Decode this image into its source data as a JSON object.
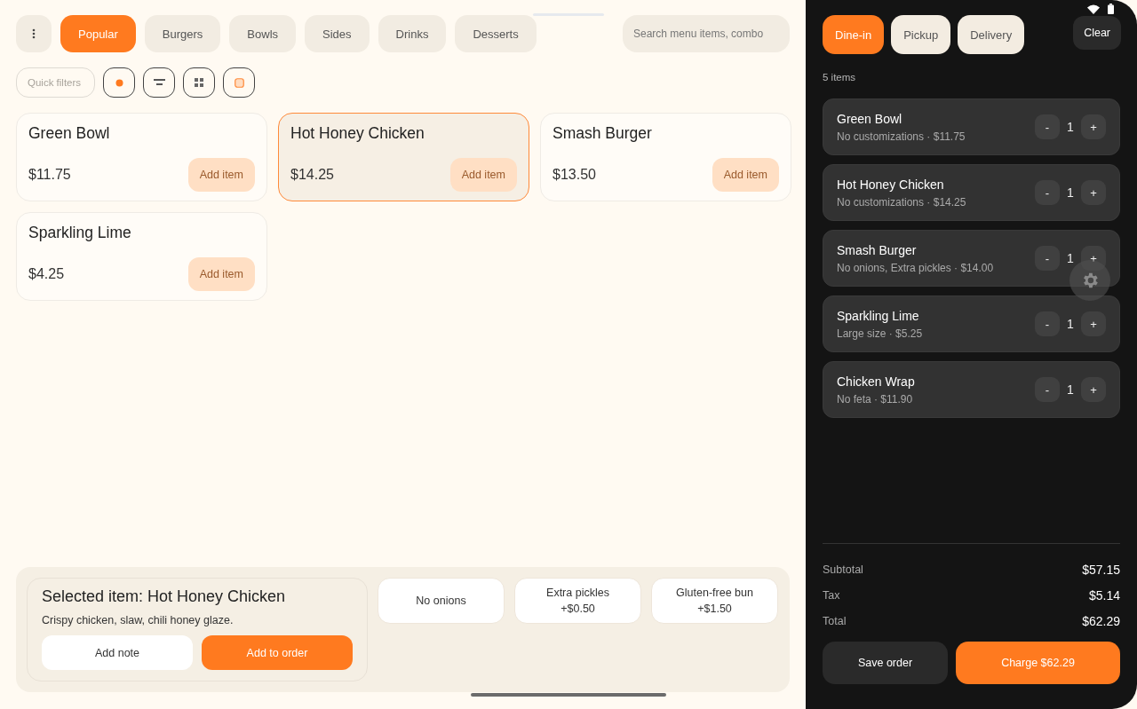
{
  "categories": [
    {
      "label": "Popular",
      "selected": true
    },
    {
      "label": "Burgers",
      "selected": false
    },
    {
      "label": "Bowls",
      "selected": false
    },
    {
      "label": "Sides",
      "selected": false
    },
    {
      "label": "Drinks",
      "selected": false
    },
    {
      "label": "Desserts",
      "selected": false
    }
  ],
  "search": {
    "placeholder": "Search menu items, combo"
  },
  "quick_filters": {
    "placeholder": "Quick filters",
    "buttons": [
      {
        "kind": "dot"
      },
      {
        "kind": "lines"
      },
      {
        "kind": "grid"
      },
      {
        "kind": "square"
      }
    ]
  },
  "menu_items": [
    {
      "name": "Green Bowl",
      "price": "$11.75",
      "button": "Add item",
      "selected": false
    },
    {
      "name": "Hot Honey Chicken",
      "price": "$14.25",
      "button": "Add item",
      "selected": true
    },
    {
      "name": "Smash Burger",
      "price": "$13.50",
      "button": "Add item",
      "selected": false
    },
    {
      "name": "Sparkling Lime",
      "price": "$4.25",
      "button": "Add item",
      "selected": false
    }
  ],
  "selected_panel": {
    "title": "Selected item: Hot Honey Chicken",
    "description": "Crispy chicken, slaw, chili honey glaze.",
    "note_button": "Add note",
    "add_button": "Add to order",
    "options": [
      {
        "label": "No onions"
      },
      {
        "label": "Extra pickles",
        "price": "+$0.50"
      },
      {
        "label": "Gluten-free bun",
        "price": "+$1.50"
      }
    ]
  },
  "order": {
    "modes": [
      {
        "label": "Dine-in",
        "selected": true
      },
      {
        "label": "Pickup",
        "selected": false
      },
      {
        "label": "Delivery",
        "selected": false
      }
    ],
    "clear": "Clear",
    "count": "5 items",
    "lines": [
      {
        "name": "Green Bowl",
        "detail": "No customizations · $11.75",
        "qty": "1"
      },
      {
        "name": "Hot Honey Chicken",
        "detail": "No customizations · $14.25",
        "qty": "1"
      },
      {
        "name": "Smash Burger",
        "detail": "No onions, Extra pickles · $14.00",
        "qty": "1"
      },
      {
        "name": "Sparkling Lime",
        "detail": "Large size · $5.25",
        "qty": "1"
      },
      {
        "name": "Chicken Wrap",
        "detail": "No feta · $11.90",
        "qty": "1"
      }
    ],
    "minus": "-",
    "plus": "+",
    "totals": [
      {
        "label": "Subtotal",
        "value": "$57.15"
      },
      {
        "label": "Tax",
        "value": "$5.14"
      },
      {
        "label": "Total",
        "value": "$62.29"
      }
    ],
    "save_button": "Save order",
    "charge_button": "Charge $62.29"
  }
}
